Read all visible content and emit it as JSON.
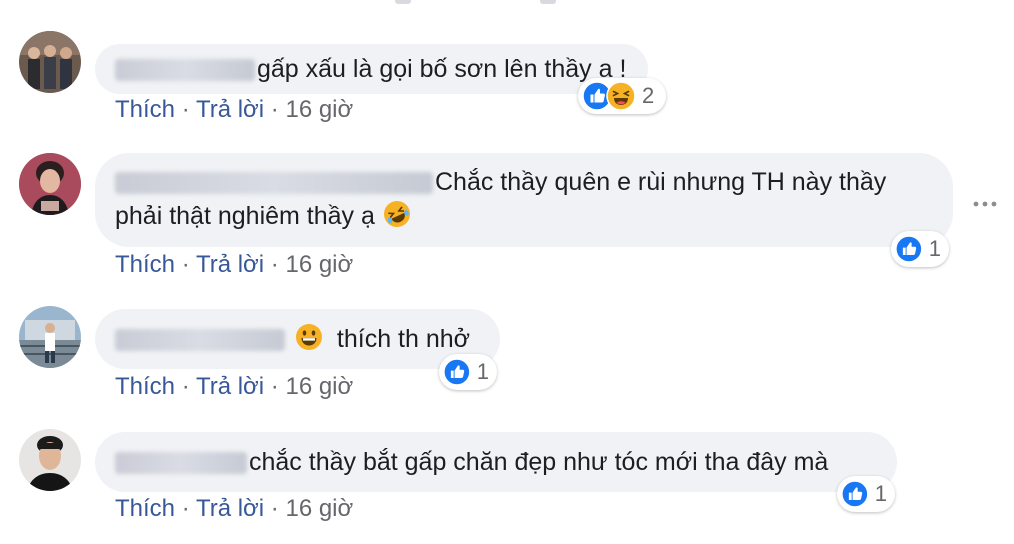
{
  "comments": [
    {
      "text": "gấp xấu là gọi bố sơn lên thầy ạ !",
      "actions": {
        "like": "Thích",
        "reply": "Trả lời",
        "time": "16 giờ"
      },
      "reactions": {
        "count": "2",
        "types": [
          "like",
          "haha"
        ]
      }
    },
    {
      "text_line1": "Chắc thầy quên e rùi nhưng TH này thầy",
      "text_line2": "phải thật nghiêm thầy ạ",
      "actions": {
        "like": "Thích",
        "reply": "Trả lời",
        "time": "16 giờ"
      },
      "reactions": {
        "count": "1",
        "types": [
          "like"
        ]
      }
    },
    {
      "text": "thích th nhở",
      "actions": {
        "like": "Thích",
        "reply": "Trả lời",
        "time": "16 giờ"
      },
      "reactions": {
        "count": "1",
        "types": [
          "like"
        ]
      }
    },
    {
      "text": "chắc thầy bắt gấp chăn đẹp như tóc mới tha đây mà",
      "actions": {
        "like": "Thích",
        "reply": "Trả lời",
        "time": "16 giờ"
      },
      "reactions": {
        "count": "1",
        "types": [
          "like"
        ]
      }
    }
  ],
  "separator": "·",
  "colors": {
    "bubble": "#f0f2f5",
    "link": "#385898",
    "like_blue": "#1877f2",
    "haha_yellow": "#f7b125"
  }
}
